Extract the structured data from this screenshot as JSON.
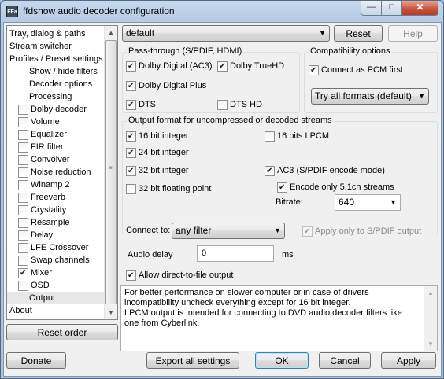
{
  "window": {
    "title": "ffdshow audio decoder configuration",
    "icon_text": "FFa",
    "min_glyph": "—",
    "max_glyph": "□",
    "close_glyph": "✕"
  },
  "tree": {
    "items": [
      {
        "label": "Tray, dialog & paths",
        "indent": 0,
        "check": null
      },
      {
        "label": "Stream switcher",
        "indent": 0,
        "check": null
      },
      {
        "label": "Profiles / Preset settings",
        "indent": 0,
        "check": null
      },
      {
        "label": "Show / hide filters",
        "indent": 1,
        "check": null
      },
      {
        "label": "Decoder options",
        "indent": 1,
        "check": null
      },
      {
        "label": "Processing",
        "indent": 1,
        "check": null
      },
      {
        "label": "Dolby decoder",
        "indent": 1,
        "check": false
      },
      {
        "label": "Volume",
        "indent": 1,
        "check": false
      },
      {
        "label": "Equalizer",
        "indent": 1,
        "check": false
      },
      {
        "label": "FIR filter",
        "indent": 1,
        "check": false
      },
      {
        "label": "Convolver",
        "indent": 1,
        "check": false
      },
      {
        "label": "Noise reduction",
        "indent": 1,
        "check": false
      },
      {
        "label": "Winamp 2",
        "indent": 1,
        "check": false
      },
      {
        "label": "Freeverb",
        "indent": 1,
        "check": false
      },
      {
        "label": "Crystality",
        "indent": 1,
        "check": false
      },
      {
        "label": "Resample",
        "indent": 1,
        "check": false
      },
      {
        "label": "Delay",
        "indent": 1,
        "check": false
      },
      {
        "label": "LFE Crossover",
        "indent": 1,
        "check": false
      },
      {
        "label": "Swap channels",
        "indent": 1,
        "check": false
      },
      {
        "label": "Mixer",
        "indent": 1,
        "check": true
      },
      {
        "label": "OSD",
        "indent": 1,
        "check": false
      },
      {
        "label": "Output",
        "indent": 1,
        "check": null,
        "selected": true
      },
      {
        "label": "About",
        "indent": 0,
        "check": null
      }
    ],
    "reset_order_label": "Reset order"
  },
  "preset": {
    "selected": "default",
    "reset_label": "Reset",
    "help_label": "Help"
  },
  "passthrough": {
    "title": "Pass-through (S/PDIF, HDMI)",
    "dolby_digital": {
      "label": "Dolby Digital (AC3)",
      "checked": true
    },
    "dolby_truehd": {
      "label": "Dolby TrueHD",
      "checked": true
    },
    "dolby_digital_plus": {
      "label": "Dolby Digital Plus",
      "checked": true
    },
    "dts": {
      "label": "DTS",
      "checked": true
    },
    "dts_hd": {
      "label": "DTS HD",
      "checked": false
    }
  },
  "compat": {
    "title": "Compatibility options",
    "connect_pcm": {
      "label": "Connect as PCM first",
      "checked": true
    },
    "formats_selected": "Try all formats (default)"
  },
  "output_format": {
    "title": "Output format for uncompressed or decoded streams",
    "int16": {
      "label": "16 bit integer",
      "checked": true
    },
    "lpcm16": {
      "label": "16 bits LPCM",
      "checked": false
    },
    "int24": {
      "label": "24 bit integer",
      "checked": true
    },
    "int32": {
      "label": "32 bit integer",
      "checked": true
    },
    "ac3": {
      "label": "AC3 (S/PDIF encode mode)",
      "checked": true
    },
    "float32": {
      "label": "32 bit floating point",
      "checked": false
    },
    "encode51": {
      "label": "Encode only 5.1ch streams",
      "checked": true
    },
    "bitrate_label": "Bitrate:",
    "bitrate_value": "640"
  },
  "connect": {
    "connect_to_label": "Connect to:",
    "connect_to_value": "any filter",
    "spdif_only": {
      "label": "Apply only to S/PDIF output",
      "checked": true
    },
    "audio_delay_label": "Audio delay",
    "audio_delay_value": "0",
    "audio_delay_unit": "ms",
    "direct_to_file": {
      "label": "Allow direct-to-file output",
      "checked": true
    }
  },
  "info_text": "For better performance on slower computer or in case of drivers incompatibility uncheck everything except for 16 bit integer.\nLPCM output is intended for connecting to DVD audio decoder filters like one from Cyberlink.",
  "footer": {
    "donate_label": "Donate",
    "export_label": "Export all settings",
    "ok_label": "OK",
    "cancel_label": "Cancel",
    "apply_label": "Apply"
  }
}
